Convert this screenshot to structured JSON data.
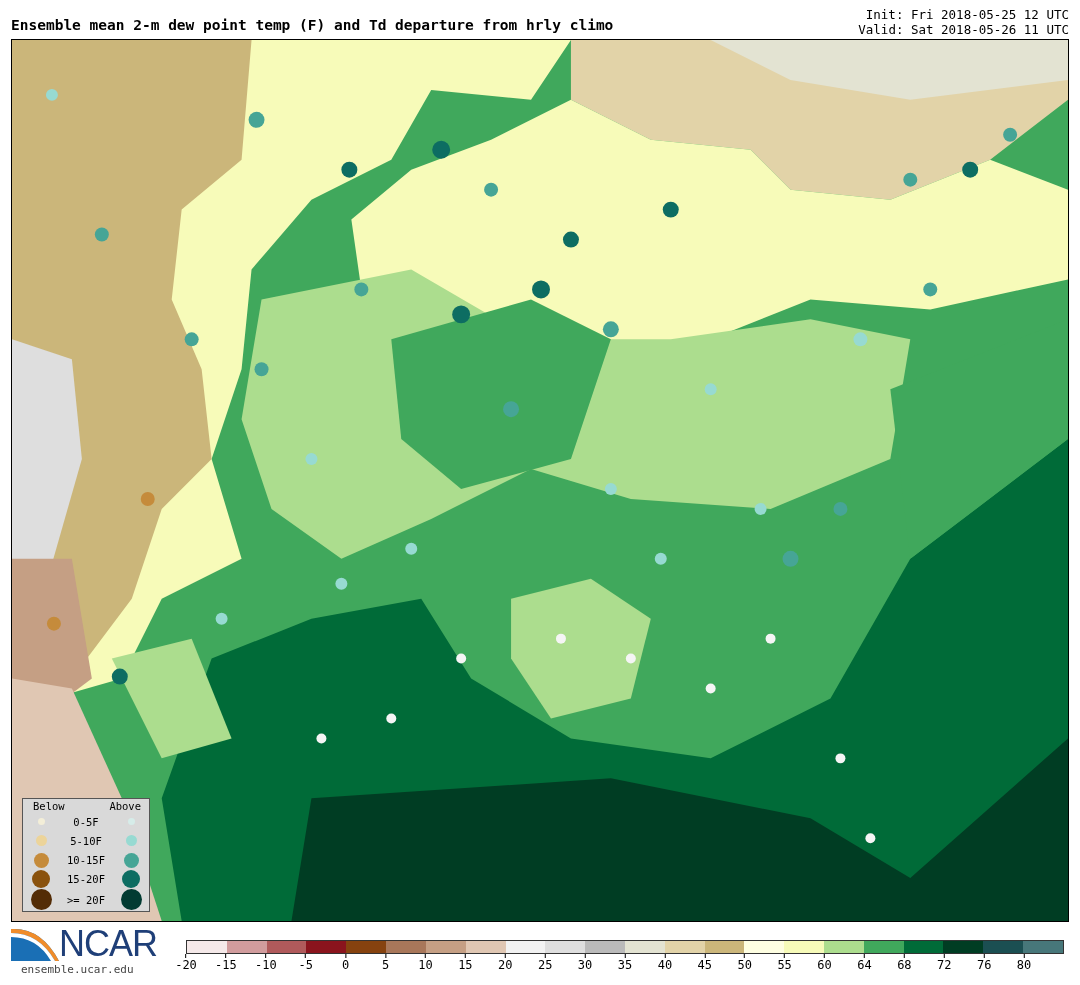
{
  "title": "Ensemble mean 2-m dew point temp (F) and Td departure from hrly climo",
  "init": "Init: Fri 2018-05-25 12 UTC",
  "valid": "Valid: Sat 2018-05-26 11 UTC",
  "legend": {
    "below_heading": "Below",
    "above_heading": "Above",
    "rows": [
      {
        "label": "0-5F",
        "below": {
          "color": "#f3eed8"
        },
        "above": {
          "color": "#d6ece9"
        }
      },
      {
        "label": "5-10F",
        "below": {
          "color": "#ecd49a"
        },
        "above": {
          "color": "#97dad2"
        }
      },
      {
        "label": "10-15F",
        "below": {
          "color": "#c58b3b"
        },
        "above": {
          "color": "#46a596"
        }
      },
      {
        "label": "15-20F",
        "below": {
          "color": "#8a520d"
        },
        "above": {
          "color": "#0d6d62"
        }
      },
      {
        "label": ">= 20F",
        "below": {
          "color": "#532c06"
        },
        "above": {
          "color": "#023b32"
        }
      }
    ]
  },
  "logo": {
    "text": "NCAR",
    "url": "ensemble.ucar.edu"
  },
  "colorbar": {
    "segments": [
      {
        "color": "#f5e9e9"
      },
      {
        "color": "#d19c9d"
      },
      {
        "color": "#b05a5b"
      },
      {
        "color": "#8a141d"
      },
      {
        "color": "#86420f"
      },
      {
        "color": "#a8775a"
      },
      {
        "color": "#c59f84"
      },
      {
        "color": "#e0c7b3"
      },
      {
        "color": "#f2f2f2"
      },
      {
        "color": "#dedede"
      },
      {
        "color": "#bababa"
      },
      {
        "color": "#e3e3d2"
      },
      {
        "color": "#e2d3a8"
      },
      {
        "color": "#cbb67a"
      },
      {
        "color": "#ffffe2"
      },
      {
        "color": "#f7fbb9"
      },
      {
        "color": "#acdd8e"
      },
      {
        "color": "#40a85c"
      },
      {
        "color": "#006b38"
      },
      {
        "color": "#003d23"
      },
      {
        "color": "#1b4f52"
      },
      {
        "color": "#47777a"
      }
    ],
    "ticks": [
      "-20",
      "-15",
      "-10",
      "-5",
      "0",
      "5",
      "10",
      "15",
      "20",
      "25",
      "30",
      "35",
      "40",
      "45",
      "50",
      "55",
      "60",
      "64",
      "68",
      "72",
      "76",
      "80"
    ]
  }
}
